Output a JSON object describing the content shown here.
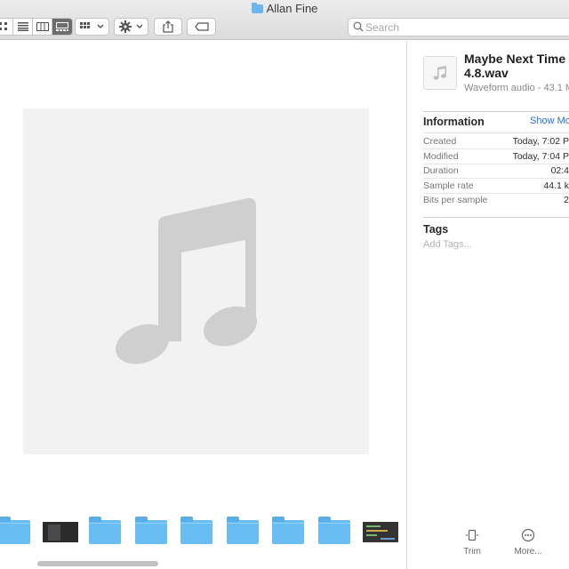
{
  "window": {
    "title": "Allan Fine"
  },
  "toolbar": {
    "view_modes": [
      "icon-view-icon",
      "list-view-icon",
      "column-view-icon",
      "gallery-view-icon"
    ],
    "active_view": "gallery-view-icon"
  },
  "search": {
    "placeholder": "Search"
  },
  "preview": {
    "icon": "music-note-icon"
  },
  "strip": {
    "thumbnails": [
      "folder",
      "screenshot",
      "folder",
      "folder",
      "folder",
      "folder",
      "folder",
      "folder",
      "code-screenshot"
    ]
  },
  "inspector": {
    "file_name": "Maybe Next Time\n4.8.wav",
    "file_kind": "Waveform audio - 43.1 M",
    "information_heading": "Information",
    "show_more": "Show Mo",
    "rows": [
      {
        "label": "Created",
        "value": "Today, 7:02 P"
      },
      {
        "label": "Modified",
        "value": "Today, 7:04 P"
      },
      {
        "label": "Duration",
        "value": "02:4"
      },
      {
        "label": "Sample rate",
        "value": "44.1 k"
      },
      {
        "label": "Bits per sample",
        "value": "2"
      }
    ],
    "tags_heading": "Tags",
    "tags_placeholder": "Add Tags...",
    "actions": [
      {
        "label": "Trim",
        "icon": "trim-icon"
      },
      {
        "label": "More...",
        "icon": "more-icon"
      }
    ]
  },
  "colors": {
    "accent_link": "#2a6fd6",
    "folder": "#68bdf3",
    "active_segment": "#6d6d6d"
  }
}
